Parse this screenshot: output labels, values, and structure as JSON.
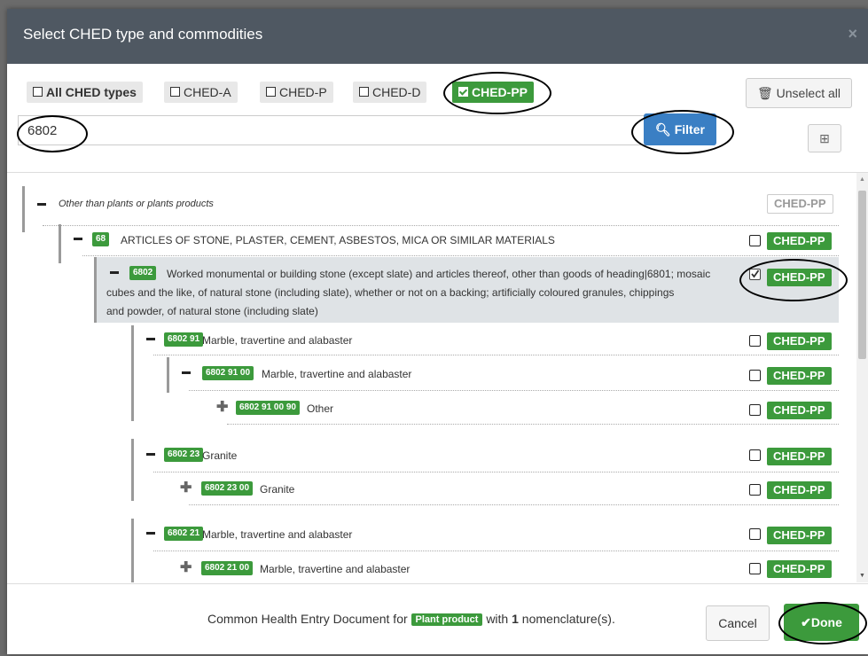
{
  "modal": {
    "title": "Select CHED type and commodities",
    "close": "×"
  },
  "toolbar": {
    "all_types": "All CHED types",
    "types": [
      "CHED-A",
      "CHED-P",
      "CHED-D"
    ],
    "selected_type": "CHED-PP",
    "unselect_all": "Unselect all",
    "search_value": "6802",
    "filter_label": "Filter",
    "expand_symbol": "⊞"
  },
  "tree": {
    "root": {
      "label": "Other than plants or plants products",
      "tag": "CHED-PP"
    },
    "items": [
      {
        "code": "68",
        "label": "ARTICLES OF STONE, PLASTER, CEMENT, ASBESTOS, MICA OR SIMILAR MATERIALS",
        "tag": "CHED-PP",
        "checked": false
      },
      {
        "code": "6802",
        "label_line1": "Worked monumental or building stone (except slate) and articles thereof, other than goods of heading|6801; mosaic",
        "label_line2": "cubes and the like, of natural stone (including slate), whether or not on a backing; artificially coloured granules, chippings",
        "label_line3": "and powder, of natural stone (including slate)",
        "tag": "CHED-PP",
        "checked": true
      },
      {
        "code": "6802 91",
        "label": "Marble, travertine and alabaster",
        "tag": "CHED-PP",
        "checked": false
      },
      {
        "code": "6802 91 00",
        "label": "Marble, travertine and alabaster",
        "tag": "CHED-PP",
        "checked": false
      },
      {
        "code": "6802 91 00 90",
        "label": "Other",
        "tag": "CHED-PP",
        "checked": false
      },
      {
        "code": "6802 23",
        "label": "Granite",
        "tag": "CHED-PP",
        "checked": false
      },
      {
        "code": "6802 23 00",
        "label": "Granite",
        "tag": "CHED-PP",
        "checked": false
      },
      {
        "code": "6802 21",
        "label": "Marble, travertine and alabaster",
        "tag": "CHED-PP",
        "checked": false
      },
      {
        "code": "6802 21 00",
        "label": "Marble, travertine and alabaster",
        "tag": "CHED-PP",
        "checked": false
      }
    ]
  },
  "footer": {
    "text_before": "Common Health Entry Document for",
    "product_badge": "Plant product",
    "text_with": "with",
    "count": "1",
    "text_after": "nomenclature(s).",
    "cancel": "Cancel",
    "done": "Done"
  },
  "colors": {
    "header": "#4f5862",
    "green": "#3c9a3c",
    "blue": "#3a7fc4"
  }
}
